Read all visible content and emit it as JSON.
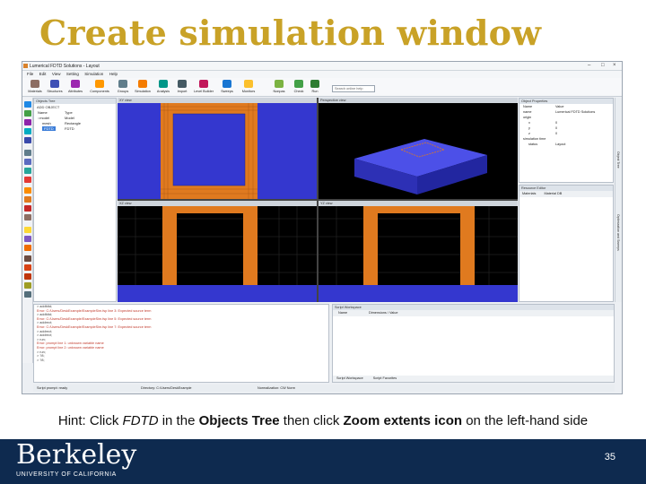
{
  "slide": {
    "title": "Create simulation window",
    "hint_parts": [
      "Hint: Click ",
      "FDTD",
      " in the ",
      "Objects Tree",
      " then click ",
      "Zoom extents icon",
      " on the left-hand side"
    ],
    "page_number": "35"
  },
  "footer": {
    "logo_word": "Berkeley",
    "logo_sub": "UNIVERSITY OF CALIFORNIA"
  },
  "app": {
    "window_title": "Lumerical FDTD Solutions - Layout",
    "menu": [
      "File",
      "Edit",
      "View",
      "Setting",
      "Simulation",
      "Help"
    ],
    "toolbar": [
      "Materials",
      "Structures",
      "Attributes",
      "Components",
      "Groups",
      "Simulation",
      "Analysis",
      "Import",
      "Level Builder",
      "Sweeps",
      "Monitors",
      "Nonpas",
      "Check",
      "Run"
    ],
    "search_placeholder": "Search online help",
    "objects_tree": {
      "title": "Objects Tree",
      "header_label": "ADD OBJECT",
      "columns": [
        "Name",
        "Type"
      ],
      "rows": [
        {
          "name": "::model",
          "type": "Model"
        },
        {
          "name": "mesh",
          "type": "Rectangle"
        },
        {
          "name": "FDTD",
          "type": "FDTD"
        }
      ]
    },
    "views": {
      "xy": "XY view",
      "perspective": "Perspective view",
      "xz": "XZ view",
      "yz": "YZ view"
    },
    "object_properties": {
      "title": "Object Properties",
      "columns": [
        "Name",
        "Value"
      ],
      "rows": [
        {
          "name": "name",
          "value": "Lumerical FDTD Solutions"
        },
        {
          "name": "origin",
          "value": ""
        },
        {
          "name": "x",
          "value": "0"
        },
        {
          "name": "y",
          "value": "0"
        },
        {
          "name": "z",
          "value": "0"
        },
        {
          "name": "simulation time",
          "value": ""
        },
        {
          "name": "status",
          "value": "Layout"
        }
      ]
    },
    "resource_editor": {
      "title": "Resource Editor",
      "tabs": [
        "Materials",
        "Material DB"
      ]
    },
    "right_vtabs": [
      "Object Tree",
      "Optimization and Sweeps"
    ],
    "log": {
      "lines": [
        {
          "text": "> addfdtd;",
          "error": false
        },
        {
          "text": "Error: C:/Users/DeskExample/ExampleSim.fsp line 3: Expected source term",
          "error": true
        },
        {
          "text": "> addfdtd;",
          "error": false
        },
        {
          "text": "Error: C:/Users/DeskExample/ExampleSim.fsp line 5: Expected source term",
          "error": true
        },
        {
          "text": "> addrect;",
          "error": false
        },
        {
          "text": "Error: C:/Users/DeskExample/ExampleSim.fsp line 7: Expected source term",
          "error": true
        },
        {
          "text": "> addrect;",
          "error": false
        },
        {
          "text": "> addrect;",
          "error": false
        },
        {
          "text": "> run;",
          "error": false
        },
        {
          "text": "Error: prompt line 1: unknown variable name",
          "error": true
        },
        {
          "text": "Error: prompt line 2: unknown variable name",
          "error": true
        },
        {
          "text": "> run;",
          "error": false
        },
        {
          "text": "> ?8;",
          "error": false
        },
        {
          "text": "> ?8;",
          "error": false
        }
      ]
    },
    "script_prompt": {
      "title": "Script Workspace",
      "columns": [
        "Name",
        "Dimensions / Value"
      ],
      "tabs": [
        "Script Workspace",
        "Script Favorites"
      ]
    },
    "statusbar": {
      "left": "Script prompt: ready",
      "middle": "Directory: C:/Users/DeskExample",
      "right": "Normalization: CW Norm"
    }
  },
  "colors": {
    "title": "#c9a227",
    "footer_bg": "#0e2a4f",
    "sim_blue": "#3437cf",
    "structure_orange": "#e07a1f"
  }
}
